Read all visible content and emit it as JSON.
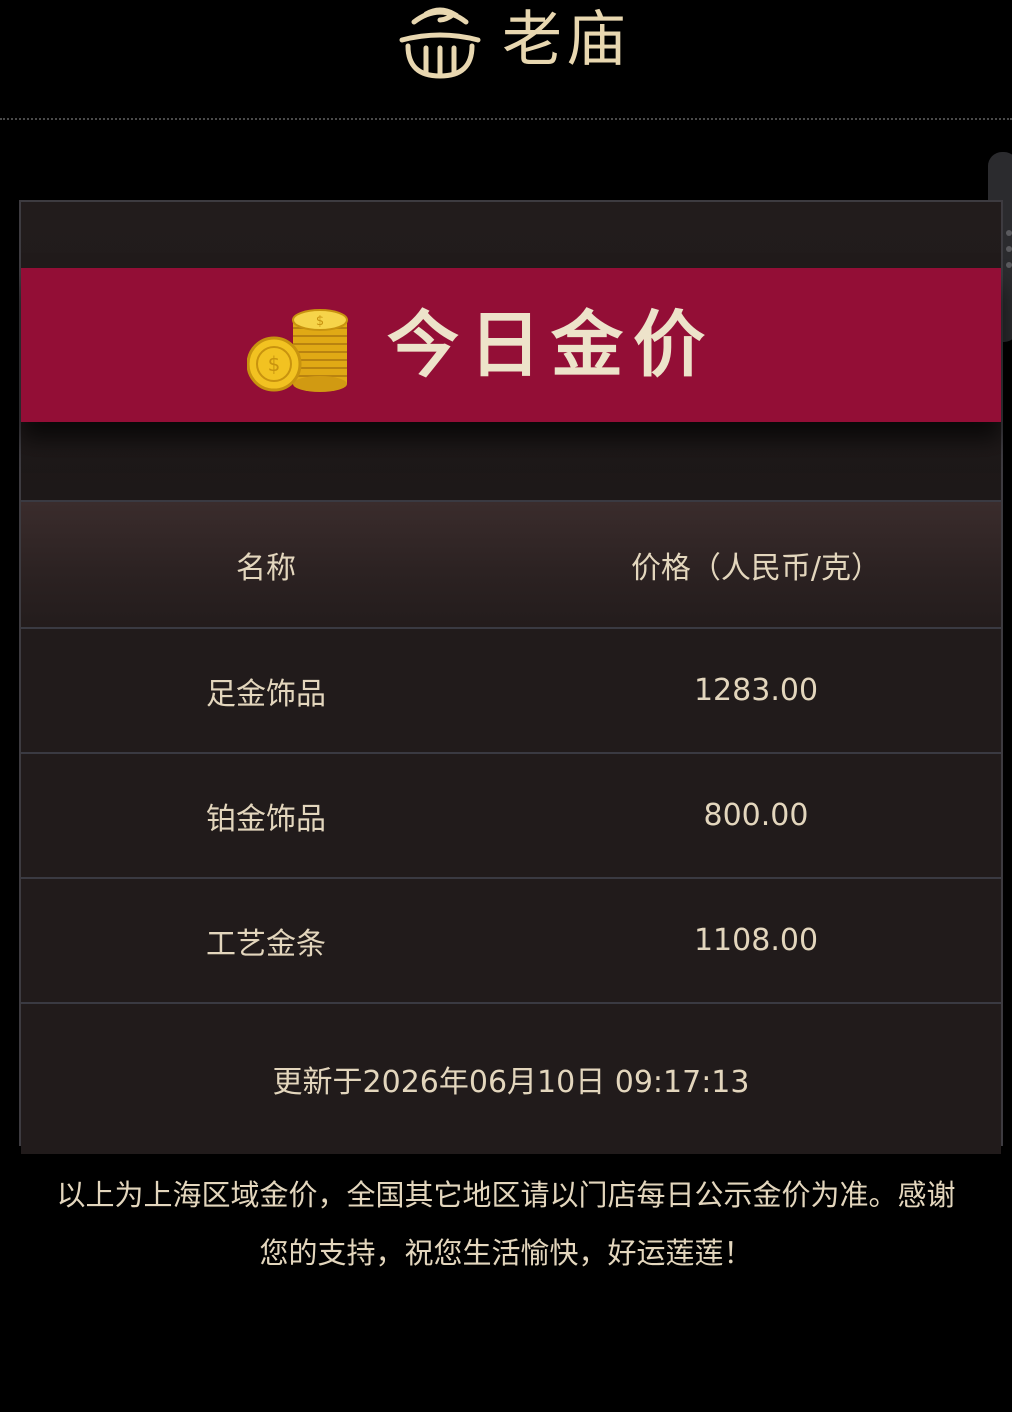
{
  "header": {
    "brand_name": "老庙",
    "logo_icon": "temple-roof-logo-icon"
  },
  "banner": {
    "icon": "gold-coins-icon",
    "title": "今日金价"
  },
  "table": {
    "columns": [
      "名称",
      "价格（人民币/克）"
    ],
    "rows": [
      {
        "name": "足金饰品",
        "price": "1283.00"
      },
      {
        "name": "铂金饰品",
        "price": "800.00"
      },
      {
        "name": "工艺金条",
        "price": "1108.00"
      }
    ],
    "updated": "更新于2026年06月10日 09:17:13"
  },
  "notice": {
    "line1": "以上为上海区域金价，全国其它地区请以门店每日公示金价为准。感谢",
    "line2": "您的支持，祝您生活愉快，好运莲莲！"
  },
  "colors": {
    "background": "#000000",
    "banner_red": "#930e36",
    "card": "#211b1b",
    "text_gold": "#e3d6bd",
    "coin_gold": "#f2c221"
  }
}
